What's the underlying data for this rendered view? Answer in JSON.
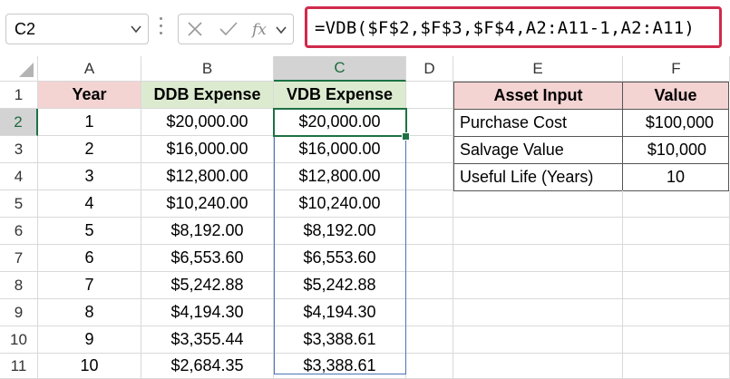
{
  "formula_bar": {
    "name_box": "C2",
    "cancel_icon": "x-icon",
    "enter_icon": "check-icon",
    "function_icon": "fx-icon",
    "formula": "=VDB($F$2,$F$3,$F$4,A2:A11-1,A2:A11)"
  },
  "columns": [
    "A",
    "B",
    "C",
    "D",
    "E",
    "F"
  ],
  "rows": [
    "1",
    "2",
    "3",
    "4",
    "5",
    "6",
    "7",
    "8",
    "9",
    "10",
    "11"
  ],
  "table": {
    "headers": {
      "year": "Year",
      "ddb": "DDB Expense",
      "vdb": "VDB Expense"
    },
    "rows": [
      {
        "year": "1",
        "ddb": "$20,000.00",
        "vdb": "$20,000.00"
      },
      {
        "year": "2",
        "ddb": "$16,000.00",
        "vdb": "$16,000.00"
      },
      {
        "year": "3",
        "ddb": "$12,800.00",
        "vdb": "$12,800.00"
      },
      {
        "year": "4",
        "ddb": "$10,240.00",
        "vdb": "$10,240.00"
      },
      {
        "year": "5",
        "ddb": "$8,192.00",
        "vdb": "$8,192.00"
      },
      {
        "year": "6",
        "ddb": "$6,553.60",
        "vdb": "$6,553.60"
      },
      {
        "year": "7",
        "ddb": "$5,242.88",
        "vdb": "$5,242.88"
      },
      {
        "year": "8",
        "ddb": "$4,194.30",
        "vdb": "$4,194.30"
      },
      {
        "year": "9",
        "ddb": "$3,355.44",
        "vdb": "$3,388.61"
      },
      {
        "year": "10",
        "ddb": "$2,684.35",
        "vdb": "$3,388.61"
      }
    ]
  },
  "asset_table": {
    "headers": {
      "input": "Asset Input",
      "value": "Value"
    },
    "rows": [
      {
        "input": "Purchase Cost",
        "value": "$100,000"
      },
      {
        "input": "Salvage Value",
        "value": "$10,000"
      },
      {
        "input": "Useful Life (Years)",
        "value": "10"
      }
    ]
  },
  "colors": {
    "formula_border": "#d12a4b",
    "header_pink": "#f4d3d3",
    "header_green": "#dcebd0",
    "selection_green": "#1e7145",
    "range_blue": "#4a73b9"
  }
}
